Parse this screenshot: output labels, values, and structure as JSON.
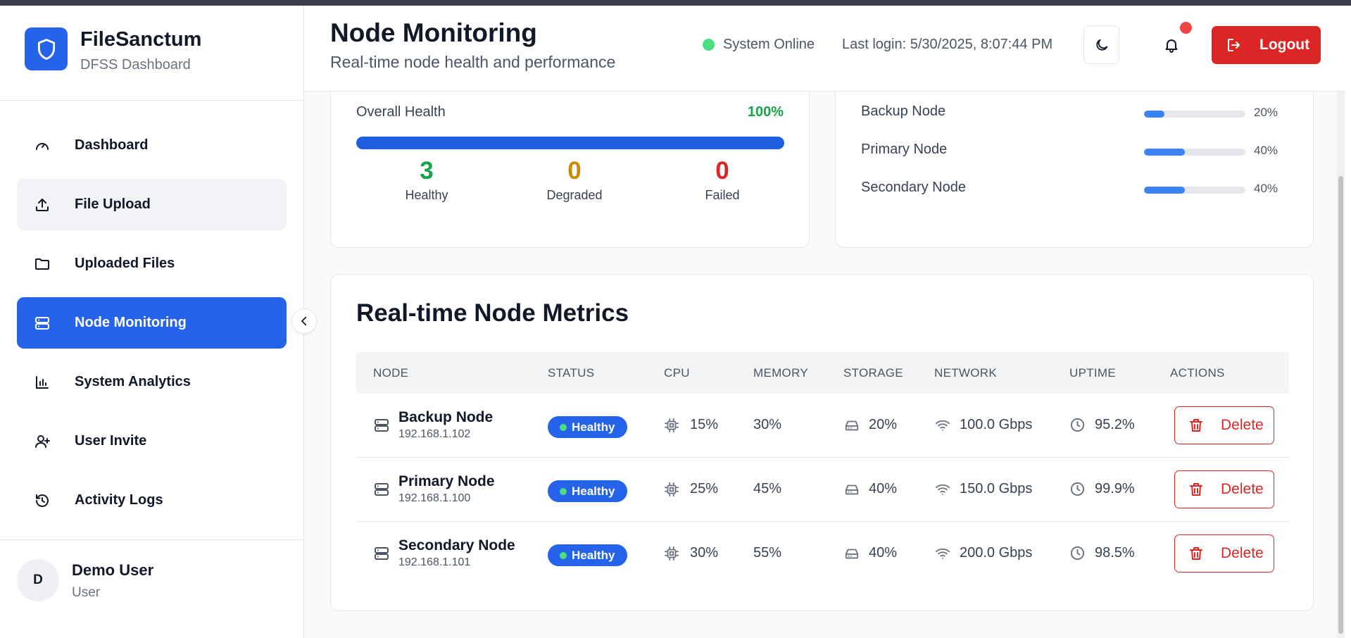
{
  "brand": {
    "name": "FileSanctum",
    "subtitle": "DFSS Dashboard"
  },
  "nav": [
    {
      "label": "Dashboard",
      "icon": "gauge-icon",
      "state": "normal"
    },
    {
      "label": "File Upload",
      "icon": "upload-icon",
      "state": "hover"
    },
    {
      "label": "Uploaded Files",
      "icon": "folder-icon",
      "state": "normal"
    },
    {
      "label": "Node Monitoring",
      "icon": "server-icon",
      "state": "active"
    },
    {
      "label": "System Analytics",
      "icon": "bar-chart-icon",
      "state": "normal"
    },
    {
      "label": "User Invite",
      "icon": "user-plus-icon",
      "state": "normal"
    },
    {
      "label": "Activity Logs",
      "icon": "history-icon",
      "state": "normal"
    }
  ],
  "user": {
    "initial": "D",
    "name": "Demo User",
    "role": "User"
  },
  "header": {
    "title": "Node Monitoring",
    "subtitle": "Real-time node health and performance",
    "status": "System Online",
    "last_login": "Last login: 5/30/2025, 8:07:44 PM",
    "logout_label": "Logout"
  },
  "health": {
    "label": "Overall Health",
    "value": "100%",
    "fraction": 1.0,
    "stats": [
      {
        "num": "3",
        "label": "Healthy",
        "color": "#16a34a"
      },
      {
        "num": "0",
        "label": "Degraded",
        "color": "#ca8a04"
      },
      {
        "num": "0",
        "label": "Failed",
        "color": "#dc2626"
      }
    ]
  },
  "distribution": [
    {
      "name": "Backup Node",
      "pct": "20%",
      "fraction": 0.2
    },
    {
      "name": "Primary Node",
      "pct": "40%",
      "fraction": 0.4
    },
    {
      "name": "Secondary Node",
      "pct": "40%",
      "fraction": 0.4
    }
  ],
  "metrics": {
    "title": "Real-time Node Metrics",
    "columns": [
      "NODE",
      "STATUS",
      "CPU",
      "MEMORY",
      "STORAGE",
      "NETWORK",
      "UPTIME",
      "ACTIONS"
    ],
    "rows": [
      {
        "name": "Backup Node",
        "ip": "192.168.1.102",
        "status": "Healthy",
        "cpu": "15%",
        "memory": "30%",
        "storage": "20%",
        "network": "100.0 Gbps",
        "uptime": "95.2%",
        "action": "Delete"
      },
      {
        "name": "Primary Node",
        "ip": "192.168.1.100",
        "status": "Healthy",
        "cpu": "25%",
        "memory": "45%",
        "storage": "40%",
        "network": "150.0 Gbps",
        "uptime": "99.9%",
        "action": "Delete"
      },
      {
        "name": "Secondary Node",
        "ip": "192.168.1.101",
        "status": "Healthy",
        "cpu": "30%",
        "memory": "55%",
        "storage": "40%",
        "network": "200.0 Gbps",
        "uptime": "98.5%",
        "action": "Delete"
      }
    ]
  },
  "colors": {
    "accent": "#2563eb",
    "danger": "#dc2626",
    "success": "#16a34a",
    "online": "#4ade80"
  }
}
